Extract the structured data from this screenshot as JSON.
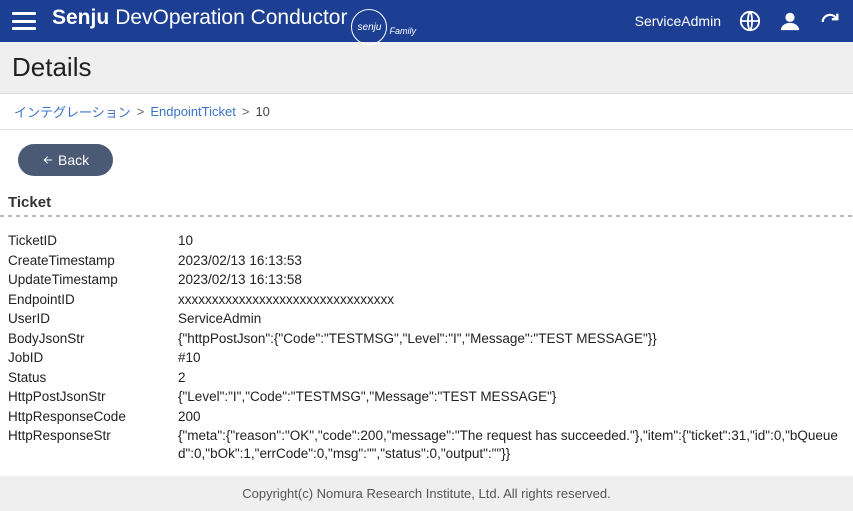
{
  "topbar": {
    "brand_bold": "Senju",
    "brand_rest": "DevOperation Conductor",
    "brand_sub": "senju",
    "brand_family": "Family",
    "user": "ServiceAdmin"
  },
  "page_title": "Details",
  "breadcrumb": {
    "items": [
      {
        "label": "インテグレーション",
        "link": true
      },
      {
        "label": "EndpointTicket",
        "link": true
      },
      {
        "label": "10",
        "link": false
      }
    ]
  },
  "back_label": "Back",
  "section_title": "Ticket",
  "fields": [
    {
      "label": "TicketID",
      "value": "10"
    },
    {
      "label": "CreateTimestamp",
      "value": "2023/02/13 16:13:53"
    },
    {
      "label": "UpdateTimestamp",
      "value": "2023/02/13 16:13:58"
    },
    {
      "label": "EndpointID",
      "value": "xxxxxxxxxxxxxxxxxxxxxxxxxxxxxxxx"
    },
    {
      "label": "UserID",
      "value": "ServiceAdmin"
    },
    {
      "label": "BodyJsonStr",
      "value": "{\"httpPostJson\":{\"Code\":\"TESTMSG\",\"Level\":\"I\",\"Message\":\"TEST MESSAGE\"}}"
    },
    {
      "label": "JobID",
      "value": "#10"
    },
    {
      "label": "Status",
      "value": "2"
    },
    {
      "label": "HttpPostJsonStr",
      "value": "{\"Level\":\"I\",\"Code\":\"TESTMSG\",\"Message\":\"TEST MESSAGE\"}"
    },
    {
      "label": "HttpResponseCode",
      "value": "200"
    },
    {
      "label": "HttpResponseStr",
      "value": "{\"meta\":{\"reason\":\"OK\",\"code\":200,\"message\":\"The request has succeeded.\"},\"item\":{\"ticket\":31,\"id\":0,\"bQueued\":0,\"bOk\":1,\"errCode\":0,\"msg\":\"\",\"status\":0,\"output\":\"\"}}"
    }
  ],
  "footer": "Copyright(c) Nomura Research Institute, Ltd. All rights reserved."
}
